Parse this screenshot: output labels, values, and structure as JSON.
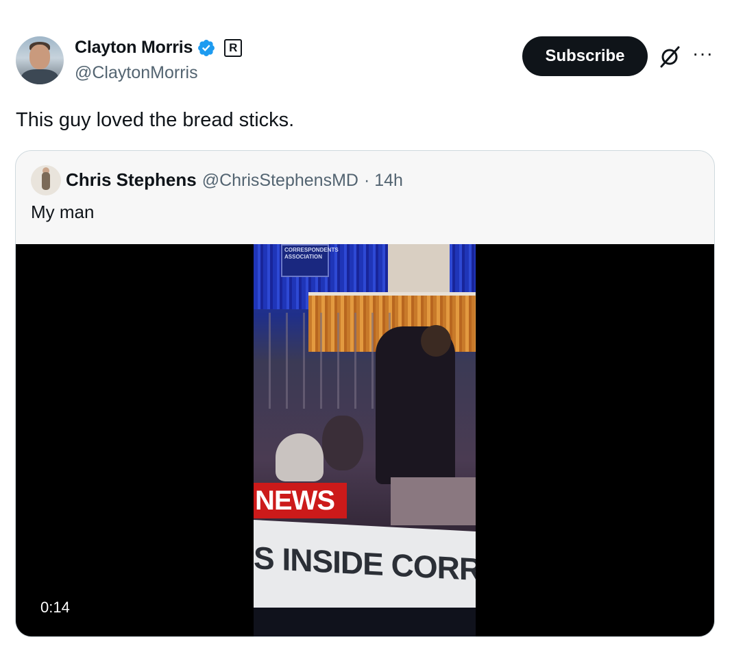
{
  "author": {
    "name": "Clayton Morris",
    "handle": "@ClaytonMorris",
    "affiliate_badge": "R"
  },
  "actions": {
    "subscribe_label": "Subscribe",
    "more_label": "···"
  },
  "tweet": {
    "text": "This guy loved the bread sticks."
  },
  "quoted": {
    "name": "Chris Stephens",
    "handle": "@ChrisStephensMD",
    "time": "· 14h",
    "text": "My man",
    "video": {
      "duration": "0:14",
      "sign_text": "CORRESPONDENTS ASSOCIATION",
      "news_text": "NEWS",
      "ticker_text": "S INSIDE CORRESPON"
    }
  },
  "colors": {
    "verified": "#1d9bf0",
    "button_bg": "#0f1419",
    "secondary_text": "#536471",
    "quote_bg": "#f7f7f7"
  }
}
